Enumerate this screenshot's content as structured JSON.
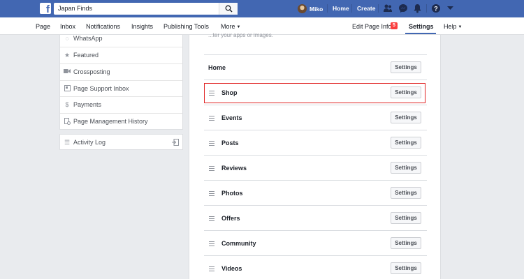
{
  "topbar": {
    "search_value": "Japan Finds",
    "user_name": "Miko",
    "home_label": "Home",
    "create_label": "Create"
  },
  "navbar": {
    "items": [
      "Page",
      "Inbox",
      "Notifications",
      "Insights",
      "Publishing Tools",
      "More"
    ],
    "edit_page_info": "Edit Page Info",
    "edit_badge": "5",
    "settings": "Settings",
    "help": "Help"
  },
  "sidebar": {
    "items": [
      {
        "label": "WhatsApp",
        "icon": "whatsapp-icon"
      },
      {
        "label": "Featured",
        "icon": "star-icon"
      },
      {
        "label": "Crossposting",
        "icon": "video-camera-icon"
      },
      {
        "label": "Page Support Inbox",
        "icon": "support-inbox-icon"
      },
      {
        "label": "Payments",
        "icon": "dollar-icon"
      },
      {
        "label": "Page Management History",
        "icon": "history-icon"
      }
    ],
    "activity_log": "Activity Log"
  },
  "main": {
    "cutoff_text": "...ter your apps or images.",
    "button_label": "Settings",
    "tabs": [
      {
        "label": "Home"
      },
      {
        "label": "Shop"
      },
      {
        "label": "Events"
      },
      {
        "label": "Posts"
      },
      {
        "label": "Reviews"
      },
      {
        "label": "Photos"
      },
      {
        "label": "Offers"
      },
      {
        "label": "Community"
      },
      {
        "label": "Videos"
      }
    ]
  },
  "colors": {
    "brand_blue": "#4267b2",
    "highlight_red": "#e02020",
    "badge_red": "#fa3e3e"
  }
}
